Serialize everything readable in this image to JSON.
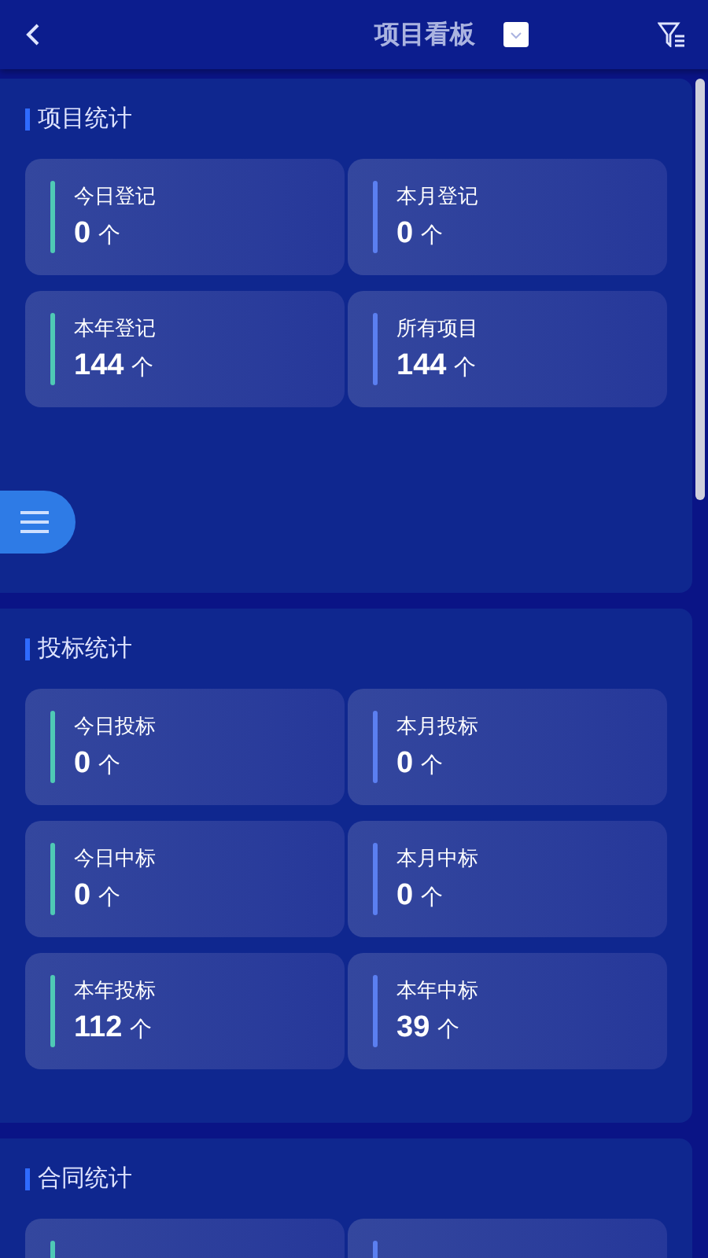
{
  "header": {
    "title": "项目看板"
  },
  "sections": [
    {
      "title": "项目统计",
      "cards": [
        {
          "label": "今日登记",
          "value": "0",
          "unit": "个",
          "color": "#4fc9b5"
        },
        {
          "label": "本月登记",
          "value": "0",
          "unit": "个",
          "color": "#5b7ff0"
        },
        {
          "label": "本年登记",
          "value": "144",
          "unit": "个",
          "color": "#4fc9b5"
        },
        {
          "label": "所有项目",
          "value": "144",
          "unit": "个",
          "color": "#5b7ff0"
        }
      ]
    },
    {
      "title": "投标统计",
      "cards": [
        {
          "label": "今日投标",
          "value": "0",
          "unit": "个",
          "color": "#4fc9b5"
        },
        {
          "label": "本月投标",
          "value": "0",
          "unit": "个",
          "color": "#5b7ff0"
        },
        {
          "label": "今日中标",
          "value": "0",
          "unit": "个",
          "color": "#4fc9b5"
        },
        {
          "label": "本月中标",
          "value": "0",
          "unit": "个",
          "color": "#5b7ff0"
        },
        {
          "label": "本年投标",
          "value": "112",
          "unit": "个",
          "color": "#4fc9b5"
        },
        {
          "label": "本年中标",
          "value": "39",
          "unit": "个",
          "color": "#5b7ff0"
        }
      ]
    },
    {
      "title": "合同统计",
      "cards": [
        {
          "color": "#4fc9b5"
        },
        {
          "color": "#5b7ff0"
        }
      ]
    }
  ]
}
